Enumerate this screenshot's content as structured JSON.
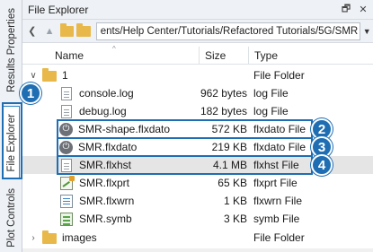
{
  "tabs": [
    {
      "label": "Results Properties"
    },
    {
      "label": "File Explorer"
    },
    {
      "label": "Plot Controls"
    }
  ],
  "panel": {
    "title": "File Explorer",
    "pin_glyph": "🗗",
    "close_glyph": "✕"
  },
  "address": {
    "path": "ents/Help Center/Tutorials/Refactored Tutorials/5G/SMR"
  },
  "columns": {
    "name": "Name",
    "size": "Size",
    "type": "Type"
  },
  "rows": [
    {
      "name": "1",
      "size": "",
      "type": "File Folder",
      "icon": "folder-icon"
    },
    {
      "name": "console.log",
      "size": "962 bytes",
      "type": "log File",
      "icon": "document-icon"
    },
    {
      "name": "debug.log",
      "size": "182 bytes",
      "type": "log File",
      "icon": "document-icon"
    },
    {
      "name": "SMR-shape.flxdato",
      "size": "572 KB",
      "type": "flxdato File",
      "icon": "power-icon"
    },
    {
      "name": "SMR.flxdato",
      "size": "219 KB",
      "type": "flxdato File",
      "icon": "power-icon"
    },
    {
      "name": "SMR.flxhst",
      "size": "4.1 MB",
      "type": "flxhst File",
      "icon": "document-icon"
    },
    {
      "name": "SMR.flxprt",
      "size": "65 KB",
      "type": "flxprt File",
      "icon": "plot-file-icon"
    },
    {
      "name": "SMR.flxwrn",
      "size": "1 KB",
      "type": "flxwrn File",
      "icon": "script-file-icon"
    },
    {
      "name": "SMR.symb",
      "size": "3 KB",
      "type": "symb File",
      "icon": "symbol-file-icon"
    },
    {
      "name": "images",
      "size": "",
      "type": "File Folder",
      "icon": "folder-icon"
    }
  ],
  "callouts": [
    "1",
    "2",
    "3",
    "4"
  ],
  "colors": {
    "accent": "#1f6eb3",
    "folder": "#e8b94a",
    "selection": "#e5e5e5"
  }
}
